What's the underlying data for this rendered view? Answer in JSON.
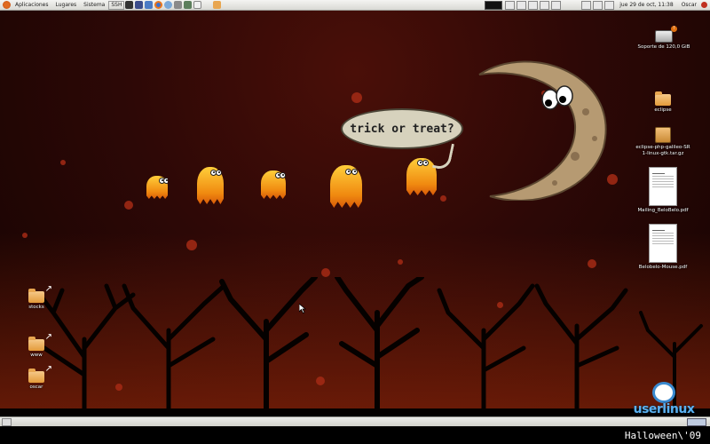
{
  "top_panel": {
    "menus": [
      "Aplicaciones",
      "Lugares",
      "Sistema"
    ],
    "ssh_label": "SSH",
    "launcher_icons": [
      "terminal-icon",
      "app-icon",
      "network-icon",
      "firefox-icon",
      "globe-icon",
      "settings-icon",
      "screenshot-icon",
      "text-editor-icon",
      "folder-icon"
    ],
    "tray_icons": [
      "monitor-icon",
      "window-icon",
      "gear-icon",
      "network-icon",
      "keyboard-icon",
      "battery-icon",
      "volume-icon",
      "mail-icon"
    ],
    "clock": "jue 29 de oct, 11:38",
    "user": "Oscar"
  },
  "desktop": {
    "bubble_text": "trick or treat?",
    "icons_right": [
      {
        "label": "Soporte de 120,0 GiB",
        "type": "drive"
      },
      {
        "label": "eclipse",
        "type": "folder"
      },
      {
        "label": "eclipse-php-galileo-SR1-linux-gtk.tar.gz",
        "type": "archive"
      },
      {
        "label": "Mailing_BeloBelo.pdf",
        "type": "pdf"
      },
      {
        "label": "Belobelo-Mouse.pdf",
        "type": "pdf"
      }
    ],
    "icons_left": [
      {
        "label": "stocks",
        "type": "folder-link"
      },
      {
        "label": "www",
        "type": "folder-link"
      },
      {
        "label": "oscar",
        "type": "folder-link"
      }
    ],
    "logo_text": "userlinux"
  },
  "caption": "Halloween\\'09",
  "colors": {
    "background": "#2d0806",
    "accent": "#f08a10",
    "logo": "#5ab0f0"
  }
}
